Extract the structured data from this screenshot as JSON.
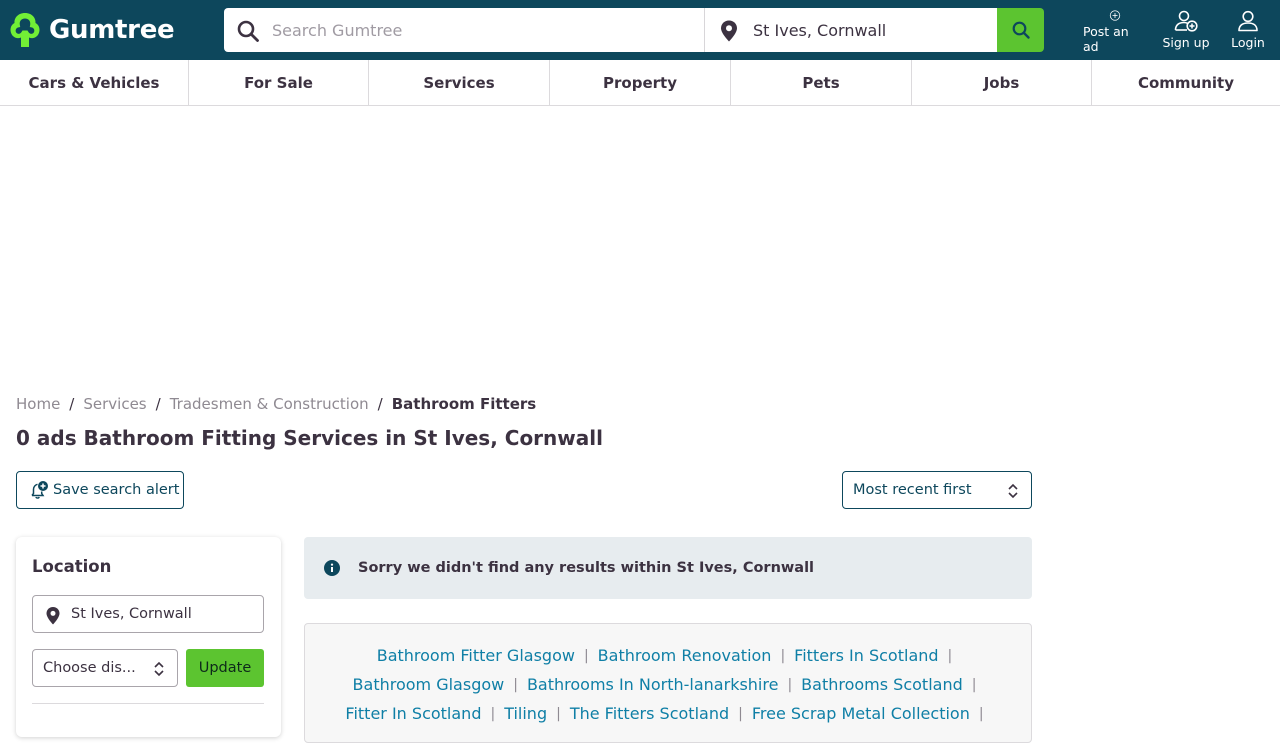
{
  "header": {
    "logo_text": "Gumtree",
    "search_placeholder": "Search Gumtree",
    "location_value": "St Ives, Cornwall",
    "actions": {
      "post": "Post an ad",
      "signup": "Sign up",
      "login": "Login"
    },
    "colors": {
      "header_bg": "#0d475c",
      "accent_green": "#5cc430",
      "logo_green": "#72ef36"
    }
  },
  "categories": [
    "Cars & Vehicles",
    "For Sale",
    "Services",
    "Property",
    "Pets",
    "Jobs",
    "Community"
  ],
  "breadcrumb": {
    "items": [
      "Home",
      "Services",
      "Tradesmen & Construction"
    ],
    "current": "Bathroom Fitters",
    "separator": "/"
  },
  "page_title": "0 ads Bathroom Fitting Services in St Ives, Cornwall",
  "save_alert_label": "Save search alert",
  "sort": {
    "selected": "Most recent first"
  },
  "sidebar": {
    "heading": "Location",
    "location_value": "St Ives, Cornwall",
    "distance_placeholder": "Choose dis...",
    "update_label": "Update"
  },
  "notice": "Sorry we didn't find any results within St Ives, Cornwall",
  "related_links": {
    "separator": "|",
    "rows": [
      [
        "Bathroom Fitter Glasgow",
        "Bathroom Renovation",
        "Fitters In Scotland"
      ],
      [
        "Bathroom Glasgow",
        "Bathrooms In North-lanarkshire",
        "Bathrooms Scotland"
      ],
      [
        "Fitter In Scotland",
        "Tiling",
        "The Fitters Scotland",
        "Free Scrap Metal Collection"
      ]
    ]
  }
}
